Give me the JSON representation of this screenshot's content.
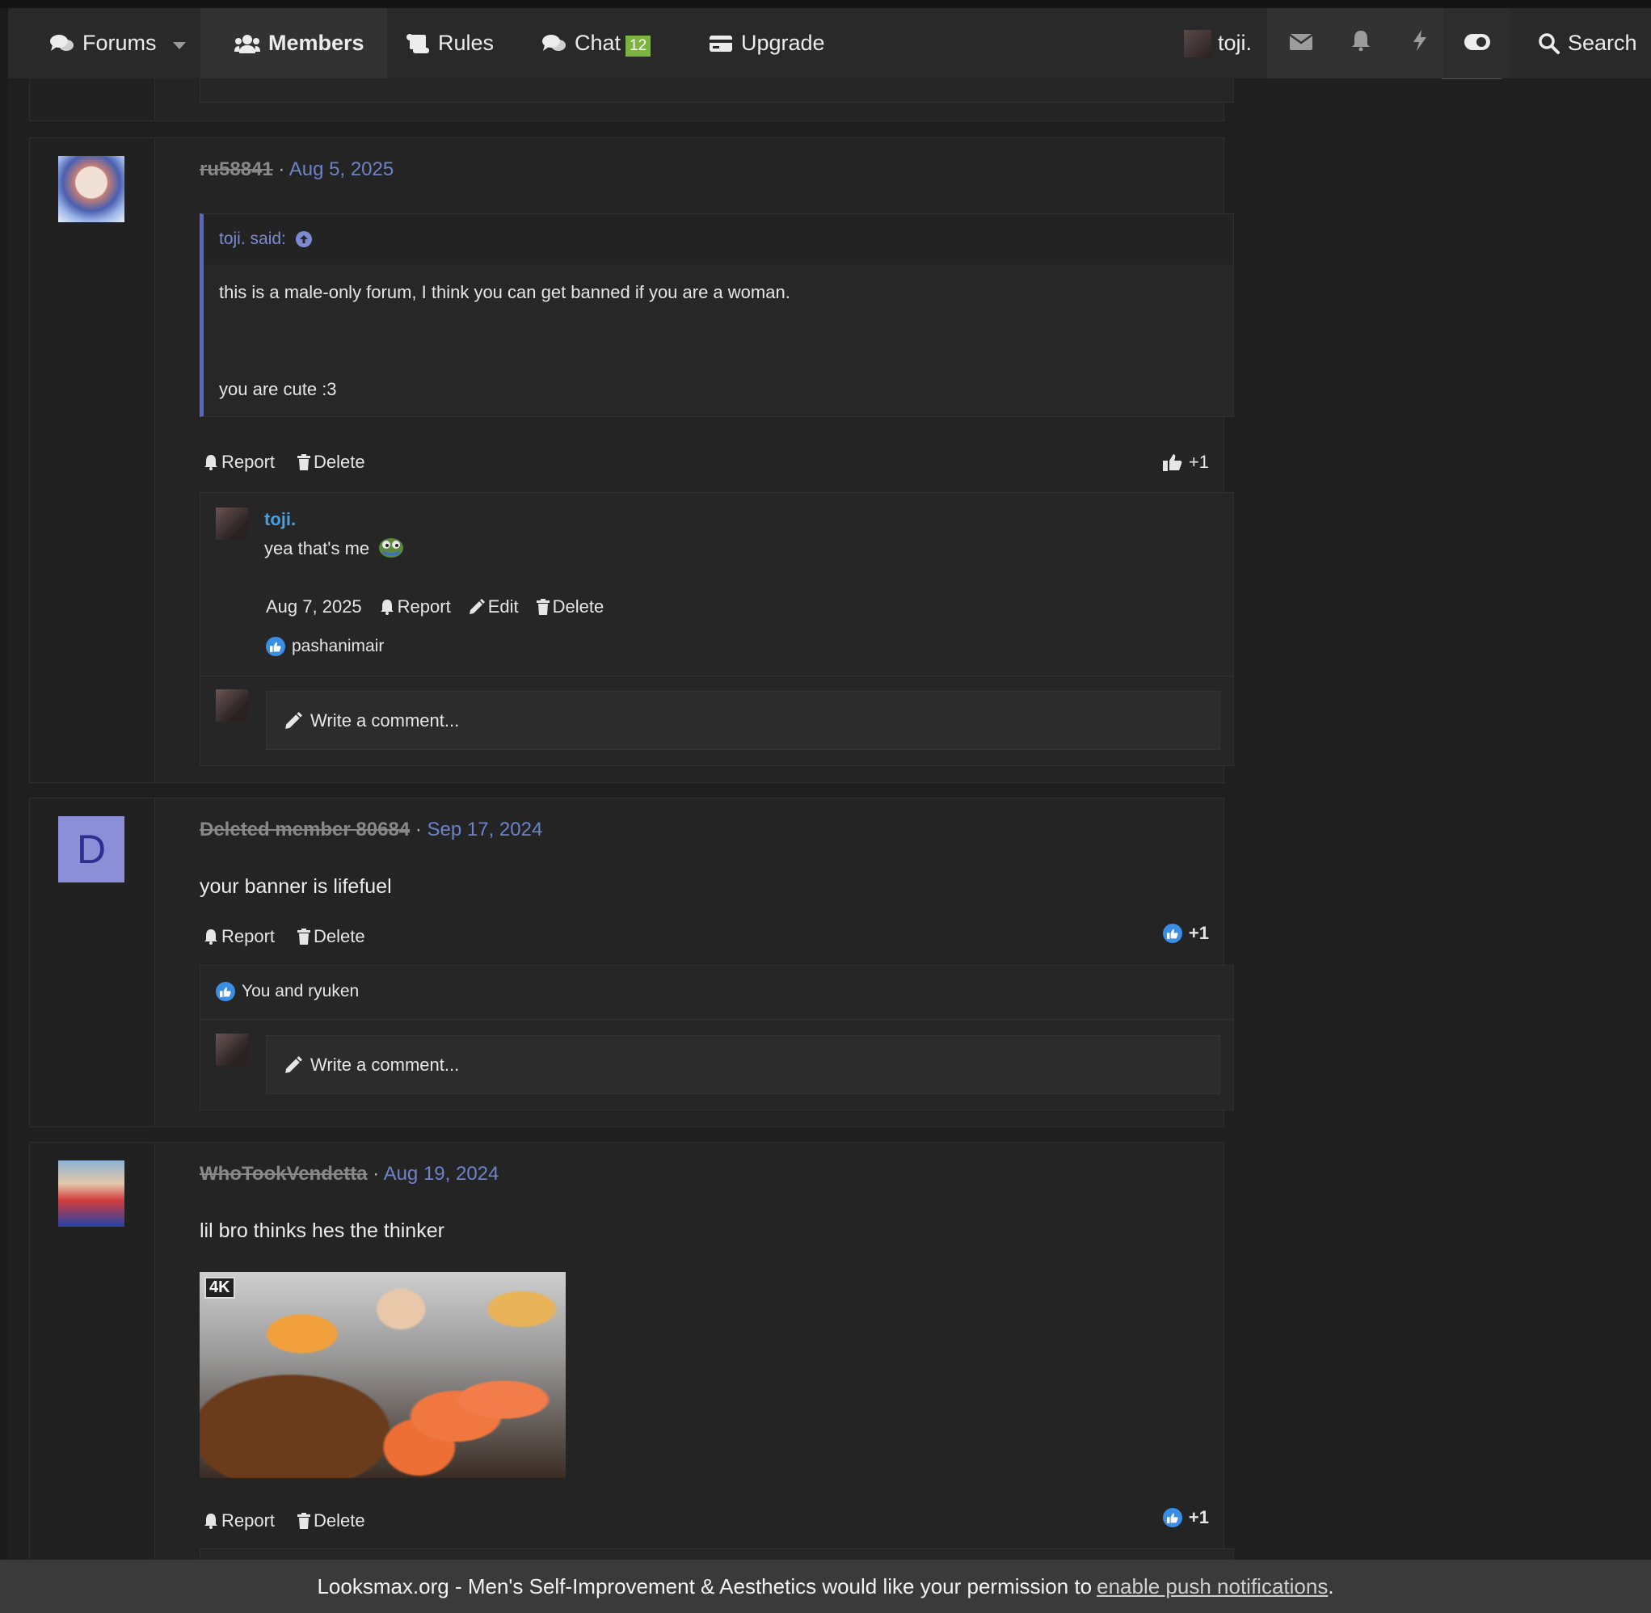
{
  "nav": {
    "forums": "Forums",
    "members": "Members",
    "rules": "Rules",
    "chat": "Chat",
    "chat_badge": "12",
    "upgrade": "Upgrade",
    "username": "toji.",
    "search": "Search"
  },
  "post1": {
    "username": "ru58841",
    "separator": "·",
    "date": "Aug 5, 2025",
    "quote_author": "toji. said:",
    "quote_line1": "this is a male-only forum, I think you can get banned if you are a woman.",
    "quote_line2": "you are cute :3",
    "report": "Report",
    "delete": "Delete",
    "reaction_count": "+1",
    "comment": {
      "author": "toji.",
      "text": "yea that's me",
      "date": "Aug 7, 2025",
      "report": "Report",
      "edit": "Edit",
      "delete": "Delete",
      "liked_by": "pashanimair"
    },
    "write_comment": "Write a comment..."
  },
  "post2": {
    "username": "Deleted member 80684",
    "avatar_letter": "D",
    "separator": "·",
    "date": "Sep 17, 2024",
    "text": "your banner is lifefuel",
    "report": "Report",
    "delete": "Delete",
    "reaction_count": "+1",
    "liked_by": "You and ryuken",
    "write_comment": "Write a comment..."
  },
  "post3": {
    "username": "WhoTookVendetta",
    "separator": "·",
    "date": "Aug 19, 2024",
    "text": "lil bro thinks hes the thinker",
    "image_badge": "4K",
    "report": "Report",
    "delete": "Delete",
    "reaction_count": "+1"
  },
  "push": {
    "text": "Looksmax.org - Men's Self-Improvement & Aesthetics would like your permission to",
    "link": "enable push notifications",
    "end": "."
  },
  "colors": {
    "accent_link": "#6d83c9",
    "comment_author": "#4a9fe0",
    "chat_badge": "#7cb342",
    "quote_border": "#5b64c7"
  }
}
